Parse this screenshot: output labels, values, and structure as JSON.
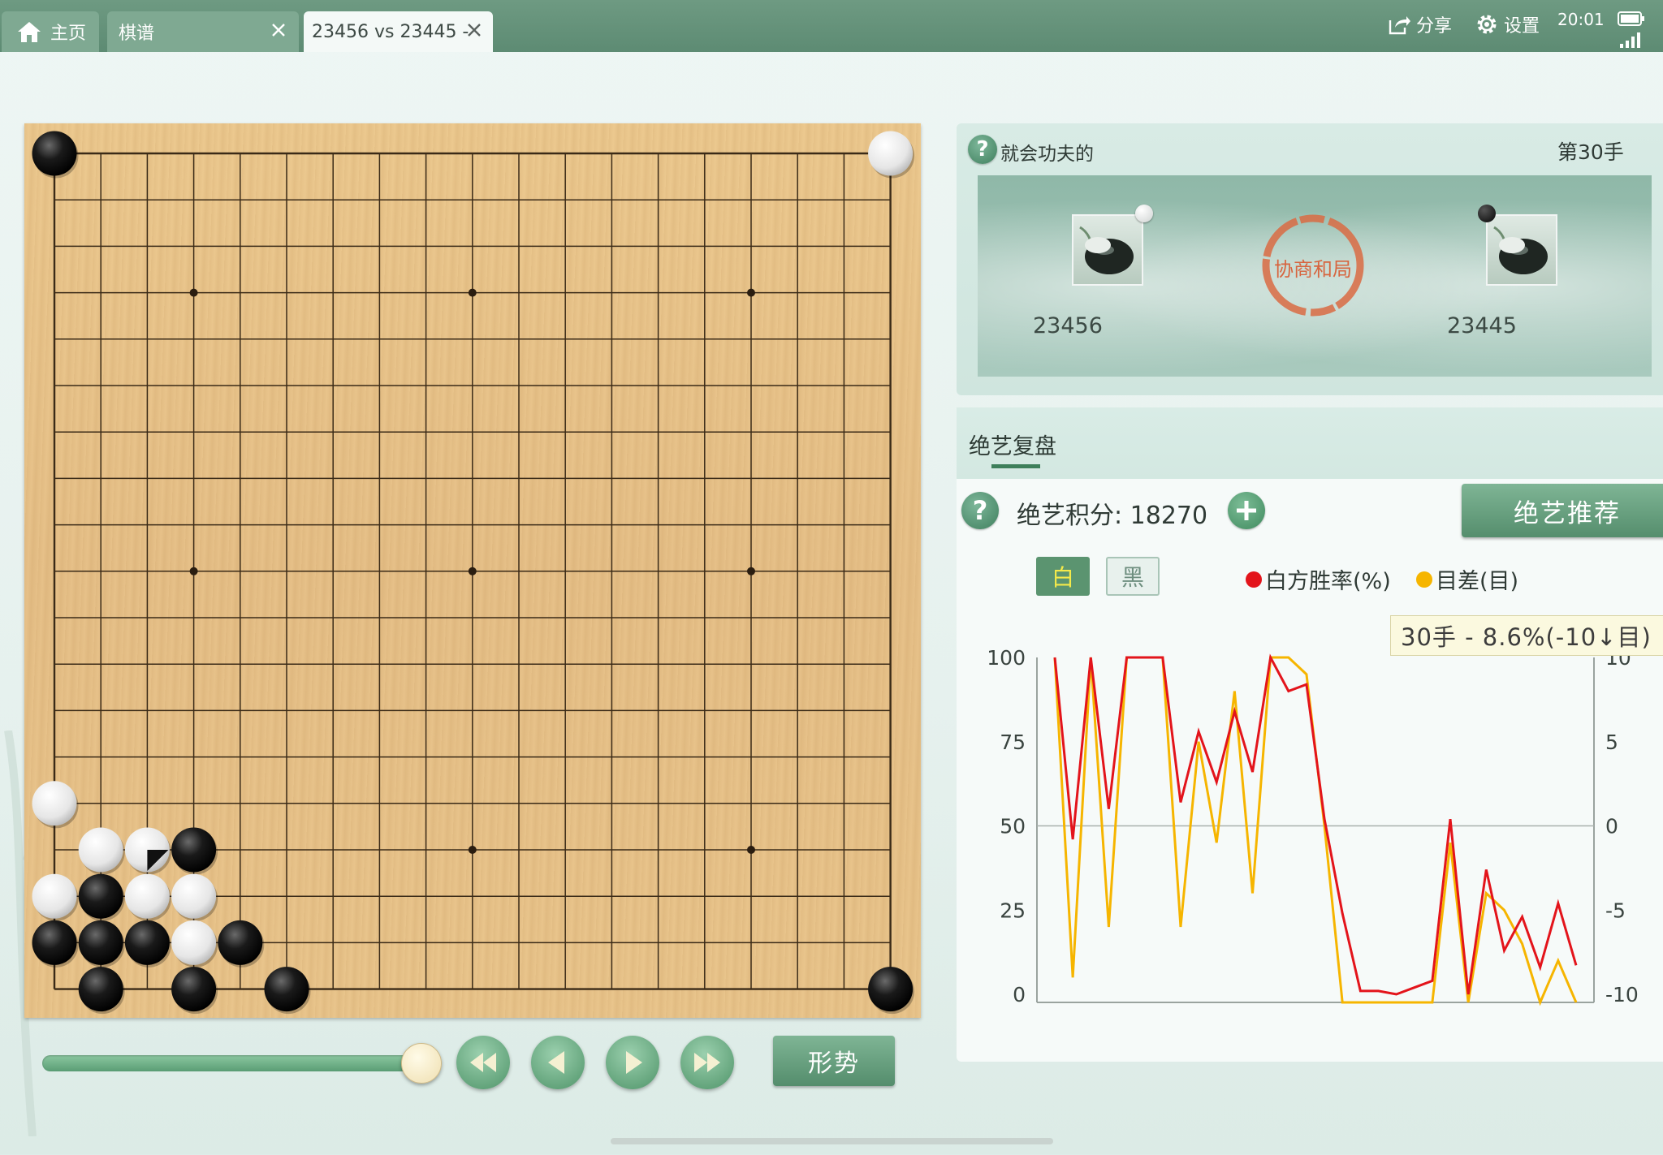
{
  "tabs": [
    {
      "label": "主页",
      "icon": "home-icon"
    },
    {
      "label": "棋谱"
    },
    {
      "label": "23456 vs 23445 -"
    }
  ],
  "top_right": {
    "share": "分享",
    "settings": "设置",
    "time": "20:01"
  },
  "game": {
    "title": "就会功夫的",
    "move": "第30手",
    "result": "协商和局",
    "player_left": {
      "name": "23456",
      "color": "white"
    },
    "player_right": {
      "name": "23445",
      "color": "black"
    }
  },
  "board": {
    "size": 19,
    "star_points": [
      [
        3,
        3
      ],
      [
        3,
        9
      ],
      [
        3,
        15
      ],
      [
        9,
        3
      ],
      [
        9,
        9
      ],
      [
        9,
        15
      ],
      [
        15,
        3
      ],
      [
        15,
        9
      ],
      [
        15,
        15
      ]
    ],
    "stones": [
      {
        "col": 0,
        "row": 0,
        "color": "black"
      },
      {
        "col": 18,
        "row": 0,
        "color": "white"
      },
      {
        "col": 18,
        "row": 18,
        "color": "black"
      },
      {
        "col": 0,
        "row": 14,
        "color": "white"
      },
      {
        "col": 1,
        "row": 15,
        "color": "white"
      },
      {
        "col": 2,
        "row": 15,
        "color": "white",
        "last": true
      },
      {
        "col": 3,
        "row": 15,
        "color": "black"
      },
      {
        "col": 0,
        "row": 16,
        "color": "white"
      },
      {
        "col": 1,
        "row": 16,
        "color": "black"
      },
      {
        "col": 2,
        "row": 16,
        "color": "white"
      },
      {
        "col": 3,
        "row": 16,
        "color": "white"
      },
      {
        "col": 0,
        "row": 17,
        "color": "black"
      },
      {
        "col": 1,
        "row": 17,
        "color": "black"
      },
      {
        "col": 2,
        "row": 17,
        "color": "black"
      },
      {
        "col": 3,
        "row": 17,
        "color": "white"
      },
      {
        "col": 4,
        "row": 17,
        "color": "black"
      },
      {
        "col": 1,
        "row": 18,
        "color": "black"
      },
      {
        "col": 3,
        "row": 18,
        "color": "black"
      },
      {
        "col": 5,
        "row": 18,
        "color": "black"
      }
    ]
  },
  "controls": {
    "slider_fraction": 1.0,
    "form_button": "形势"
  },
  "analysis": {
    "tab": "绝艺复盘",
    "score_label": "绝艺积分: 18270",
    "recommend": "绝艺推荐",
    "toggle_white": "白",
    "toggle_black": "黑",
    "legend_winrate": "白方胜率(%)",
    "legend_diff": "目差(目)",
    "tooltip": "30手 - 8.6%(-10↓目)"
  },
  "colors": {
    "winrate": "#e3141b",
    "diff": "#f6b500",
    "accent": "#5b9470"
  },
  "chart_data": {
    "type": "line",
    "x": [
      1,
      2,
      3,
      4,
      5,
      6,
      7,
      8,
      9,
      10,
      11,
      12,
      13,
      14,
      15,
      16,
      17,
      18,
      19,
      20,
      21,
      22,
      23,
      24,
      25,
      26,
      27,
      28,
      29,
      30
    ],
    "series": [
      {
        "name": "白方胜率(%)",
        "axis": "left",
        "values": [
          100,
          46,
          100,
          55,
          100,
          100,
          100,
          57,
          78,
          63,
          84,
          66,
          100,
          90,
          92,
          52,
          24,
          1,
          1,
          0,
          2,
          4,
          52,
          0,
          37,
          13,
          23,
          8,
          27,
          8.6
        ]
      },
      {
        "name": "目差(目)",
        "axis": "right",
        "values": [
          11,
          -9,
          10,
          -6,
          10,
          10,
          10,
          -6,
          5,
          -1,
          8,
          -4,
          11,
          11,
          9,
          0,
          -11,
          -11,
          -11,
          -11,
          -11,
          -11,
          -1,
          -11,
          -4,
          -5,
          -7,
          -11,
          -8,
          -11
        ]
      }
    ],
    "y_left": {
      "ticks": [
        100,
        75,
        50,
        25,
        0
      ],
      "lim": [
        0,
        100
      ]
    },
    "y_right": {
      "ticks": [
        10,
        5,
        0,
        -5,
        -10
      ],
      "lim": [
        -10,
        10
      ]
    }
  }
}
